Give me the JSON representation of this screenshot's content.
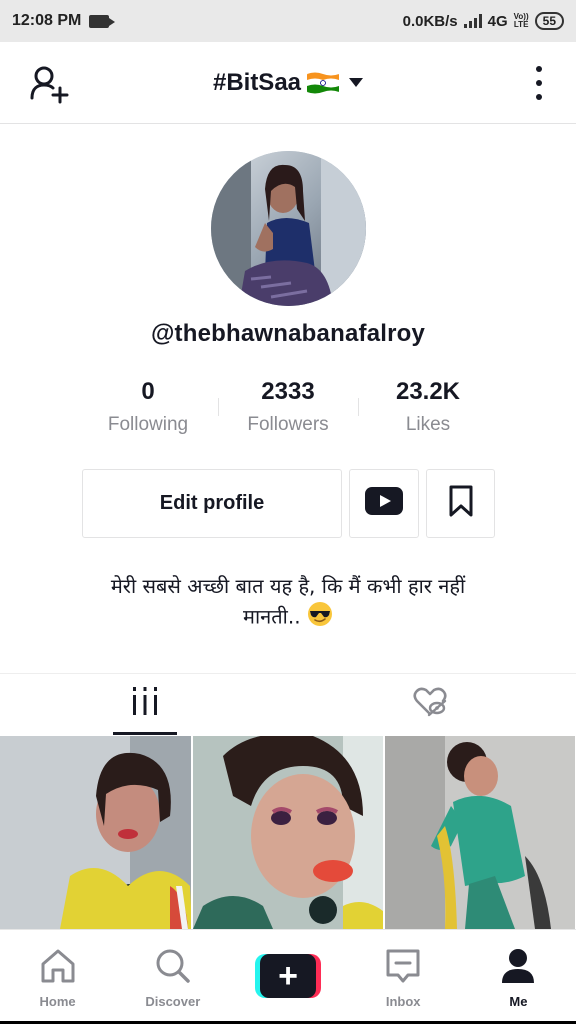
{
  "status_bar": {
    "time": "12:08 PM",
    "network_speed": "0.0KB/s",
    "network_type": "4G",
    "volte_top": "Vo))",
    "volte_bottom": "LTE",
    "battery": "55"
  },
  "header": {
    "title": "#BitSaa",
    "flag_icon": "india-flag-icon",
    "add_user_icon": "add-user-icon",
    "more_icon": "vertical-dots-icon"
  },
  "profile": {
    "username": "@thebhawnabanafalroy",
    "stats": [
      {
        "value": "0",
        "label": "Following"
      },
      {
        "value": "2333",
        "label": "Followers"
      },
      {
        "value": "23.2K",
        "label": "Likes"
      }
    ],
    "edit_profile_label": "Edit profile",
    "bio_line1": "मेरी सबसे अच्छी बात यह है, कि मैं कभी हार नहीं",
    "bio_line2": "मानती..",
    "bio_emoji": "sunglasses-emoji"
  },
  "tabs": [
    {
      "name": "videos",
      "icon": "grid-icon",
      "active": true
    },
    {
      "name": "liked",
      "icon": "hidden-heart-icon",
      "active": false
    }
  ],
  "nav": [
    {
      "label": "Home",
      "icon": "home-icon"
    },
    {
      "label": "Discover",
      "icon": "search-icon"
    },
    {
      "label": "",
      "icon": "plus-icon"
    },
    {
      "label": "Inbox",
      "icon": "inbox-icon"
    },
    {
      "label": "Me",
      "icon": "person-icon",
      "active": true
    }
  ],
  "colors": {
    "text": "#161823",
    "muted": "#8a8b91",
    "border": "#e3e3e4",
    "cyan": "#25f4ee",
    "red": "#fe2c55"
  }
}
